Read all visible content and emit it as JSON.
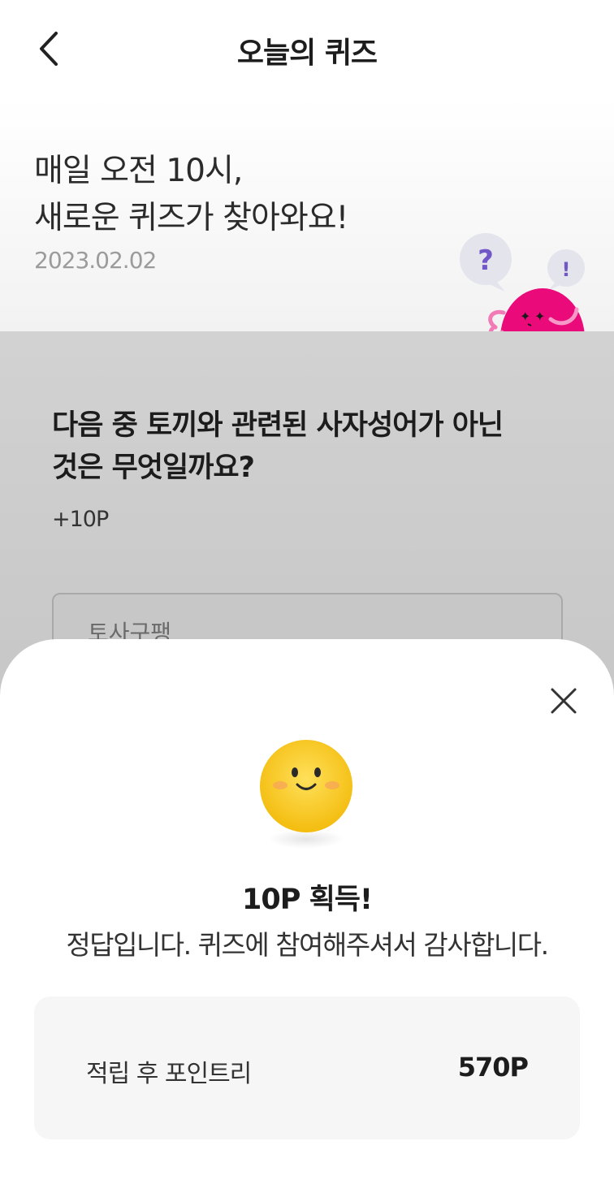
{
  "header": {
    "title": "오늘의 퀴즈",
    "back_icon": "chevron-left-icon"
  },
  "hero": {
    "headline_line1": "매일 오전 10시,",
    "headline_line2": "새로운 퀴즈가 찾아와요!",
    "date": "2023.02.02",
    "mascot_question_mark": "?",
    "mascot_exclamation_mark": "!"
  },
  "quiz": {
    "question_line1": "다음 중 토끼와 관련된 사자성어가 아닌",
    "question_line2": "것은 무엇일까요?",
    "points": "+10P",
    "options": [
      {
        "label": "토사구팽"
      }
    ]
  },
  "result_sheet": {
    "close_icon": "close-icon",
    "emoji_icon": "smiley-face-icon",
    "title": "10P 획득!",
    "message": "정답입니다. 퀴즈에 참여해주셔서 감사합니다.",
    "points_card": {
      "label": "적립 후 포인트리",
      "value": "570P"
    }
  },
  "colors": {
    "mascot_pink": "#ea0a7a",
    "bubble_purple": "#7257c6",
    "emoji_yellow": "#f6c216",
    "dim_overlay": "#c4c4c4"
  }
}
